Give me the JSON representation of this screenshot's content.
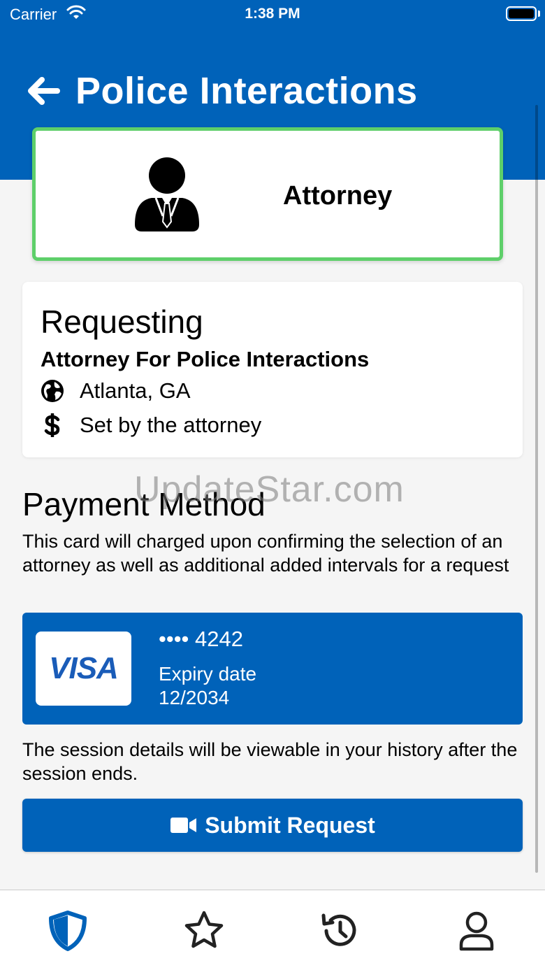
{
  "status_bar": {
    "carrier": "Carrier",
    "time": "1:38 PM"
  },
  "header": {
    "title": "Police Interactions",
    "back_icon": "arrow-left-icon"
  },
  "selection": {
    "label": "Attorney",
    "icon": "attorney-icon",
    "selected_border_color": "#5ecf6a"
  },
  "request": {
    "heading": "Requesting",
    "subtitle": "Attorney For Police Interactions",
    "location": "Atlanta, GA",
    "price": "Set by the attorney"
  },
  "payment": {
    "heading": "Payment Method",
    "description": "This card will charged upon confirming the selection of an attorney as well as additional added intervals for a request",
    "card": {
      "brand": "VISA",
      "number": "•••• 4242",
      "expiry_label": "Expiry date",
      "expiry": "12/2034"
    }
  },
  "session_note": "The session details will be viewable in your history after the session ends.",
  "submit": {
    "label": "Submit Request",
    "icon": "video-camera-icon"
  },
  "watermark": "UpdateStar.com",
  "tabs": [
    {
      "name": "shield",
      "icon": "shield-icon",
      "active": true
    },
    {
      "name": "favorites",
      "icon": "star-icon",
      "active": false
    },
    {
      "name": "history",
      "icon": "history-icon",
      "active": false
    },
    {
      "name": "profile",
      "icon": "user-icon",
      "active": false
    }
  ],
  "colors": {
    "primary": "#0062b9",
    "background": "#f5f5f5",
    "selected": "#5ecf6a"
  }
}
